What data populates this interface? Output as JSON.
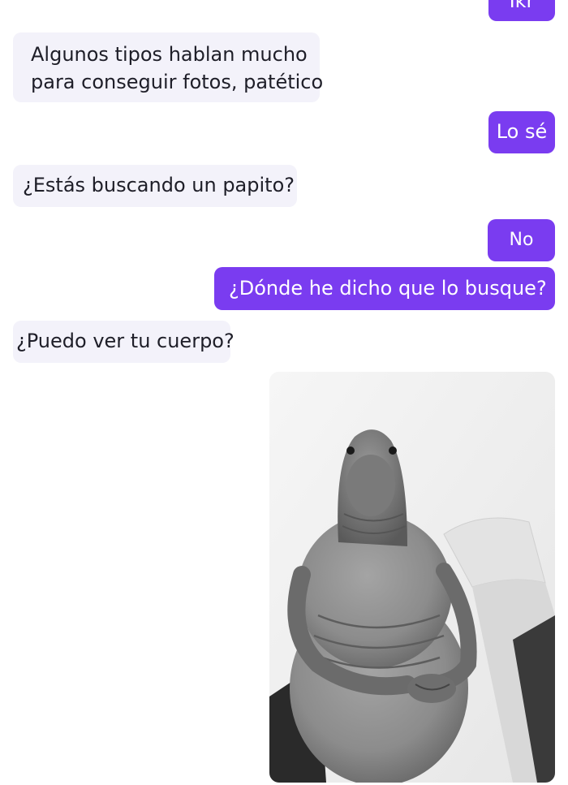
{
  "colors": {
    "incoming_bg": "#f3f2fa",
    "incoming_text": "#1e1e28",
    "outgoing_bg": "#7a3cf0",
    "outgoing_text": "#ffffff"
  },
  "messages": [
    {
      "direction": "out",
      "text": "Ikr"
    },
    {
      "direction": "in",
      "lines": [
        "Algunos tipos hablan mucho",
        "para conseguir fotos, patético"
      ]
    },
    {
      "direction": "out",
      "text": "Lo sé"
    },
    {
      "direction": "in",
      "text": "¿Estás buscando un papito?"
    },
    {
      "direction": "out",
      "text": "No"
    },
    {
      "direction": "out",
      "text": "¿Dónde he dicho que lo busque?"
    },
    {
      "direction": "in",
      "text": "¿Puedo ver tu cuerpo?"
    }
  ],
  "photo": {
    "direction": "out",
    "subject": "grayscale photo of a plump, hairless creature sitting with hands clasped"
  }
}
